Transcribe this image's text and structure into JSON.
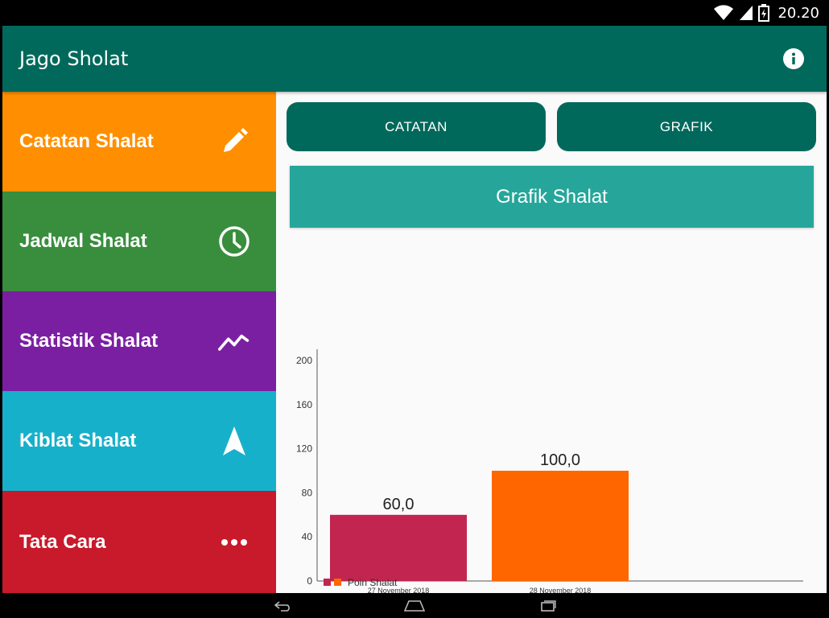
{
  "status_bar": {
    "time": "20.20",
    "icons": [
      "wifi-icon",
      "signal-icon",
      "battery-charging-icon"
    ]
  },
  "toolbar": {
    "title": "Jago Sholat",
    "action_icon": "info-icon"
  },
  "menu": {
    "items": [
      {
        "label": "Catatan Shalat",
        "icon": "pencil-icon",
        "color": "#ff8f00"
      },
      {
        "label": "Jadwal Shalat",
        "icon": "clock-icon",
        "color": "#388e3c"
      },
      {
        "label": "Statistik Shalat",
        "icon": "trending-icon",
        "color": "#7b1fa2"
      },
      {
        "label": "Kiblat Shalat",
        "icon": "navigation-arrow-icon",
        "color": "#17b0cb"
      },
      {
        "label": "Tata Cara",
        "icon": "more-horiz-icon",
        "color": "#c81a2a"
      }
    ]
  },
  "tabs": {
    "catatan_label": "CATATAN",
    "grafik_label": "GRAFIK"
  },
  "header": {
    "title": "Grafik Shalat"
  },
  "colors": {
    "primary": "#00695c",
    "header_card": "#26a69a"
  },
  "chart_data": {
    "type": "bar",
    "categories": [
      "27 November 2018",
      "28 November 2018"
    ],
    "values": [
      60,
      100
    ],
    "value_labels": [
      "60,0",
      "100,0"
    ],
    "bar_colors": [
      "#c2254f",
      "#ff6600"
    ],
    "yticks": [
      "0",
      "40",
      "80",
      "120",
      "160",
      "200"
    ],
    "ylim": [
      0,
      210
    ],
    "legend": {
      "label": "Poin Shalat",
      "swatches": [
        "#c2254f",
        "#ff6600"
      ],
      "position": "bottom-left"
    },
    "grid": false
  },
  "nav_bar": {
    "buttons": [
      "back-icon",
      "home-icon",
      "recents-icon"
    ]
  }
}
